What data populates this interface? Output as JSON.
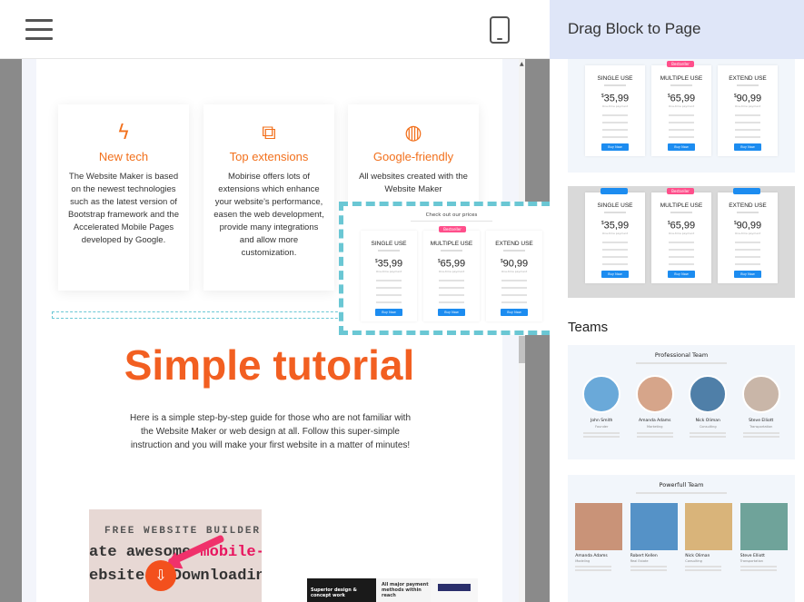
{
  "topbar": {
    "menu_icon": "hamburger-menu-icon",
    "device_icon": "mobile-phone-icon"
  },
  "features": [
    {
      "icon": "lightning-icon",
      "title": "New tech",
      "text": "The Website Maker is based on the newest technologies such as the latest version of Bootstrap framework and the Accelerated Mobile Pages developed by Google."
    },
    {
      "icon": "shapes-icon",
      "title": "Top extensions",
      "text": "Mobirise offers lots of extensions which enhance your website's performance, easen the web development, provide many integrations and allow more customization."
    },
    {
      "icon": "globe-icon",
      "title": "Google-friendly",
      "text": "All websites created with the Website Maker"
    }
  ],
  "tutorial": {
    "title": "Simple tutorial",
    "text": "Here is a simple step-by-step guide for those who are not familiar with the Website Maker or web design at all. Follow this super-simple instruction and you will make your first website in a matter of minutes!"
  },
  "promo": {
    "line1": "FREE WEBSITE BUILDER",
    "line2a": "ate awesome ",
    "line2b": "mobile-frien",
    "line3": "ebsites! Downloading and free",
    "download_icon": "cloud-download-icon"
  },
  "thumbs": {
    "dark_text": "Superior design & concept work",
    "light_text": "All major payment methods within reach"
  },
  "drag_block": {
    "title": "Check out our prices"
  },
  "sidebar": {
    "title": "Drag Block to Page",
    "category_teams": "Teams"
  },
  "pricing": {
    "plans": [
      {
        "name": "SINGLE USE",
        "price": "35,99",
        "sub": "One-time payment",
        "button": "Buy Now"
      },
      {
        "name": "MULTIPLE USE",
        "price": "65,99",
        "sub": "One-time payment",
        "button": "Buy Now",
        "badge": "Bestseller"
      },
      {
        "name": "EXTEND USE",
        "price": "90,99",
        "sub": "One-time payment",
        "button": "Buy Now"
      }
    ],
    "colors": {
      "accent": "#1c8cf0",
      "badge": "#ff4f8b"
    }
  },
  "teams": {
    "block1": {
      "title": "Professional Team",
      "members": [
        {
          "name": "John Smith",
          "role": "Founder",
          "color": "#6aa9d9"
        },
        {
          "name": "Amanda Adams",
          "role": "Marketing",
          "color": "#d6a58a"
        },
        {
          "name": "Nick Oliman",
          "role": "Consulting",
          "color": "#4f7fa8"
        },
        {
          "name": "Steve Elliott",
          "role": "Transportation",
          "color": "#c9b6a8"
        }
      ]
    },
    "block2": {
      "title": "Powerfull Team",
      "members": [
        {
          "name": "Amanda Adams",
          "role": "Modeling",
          "color": "#c99378"
        },
        {
          "name": "Robert Kellen",
          "role": "Real Estate",
          "color": "#5592c7"
        },
        {
          "name": "Nick Oliman",
          "role": "Consulting",
          "color": "#d9b47a"
        },
        {
          "name": "Steve Elliott",
          "role": "Transportation",
          "color": "#6fa39a"
        }
      ]
    }
  }
}
